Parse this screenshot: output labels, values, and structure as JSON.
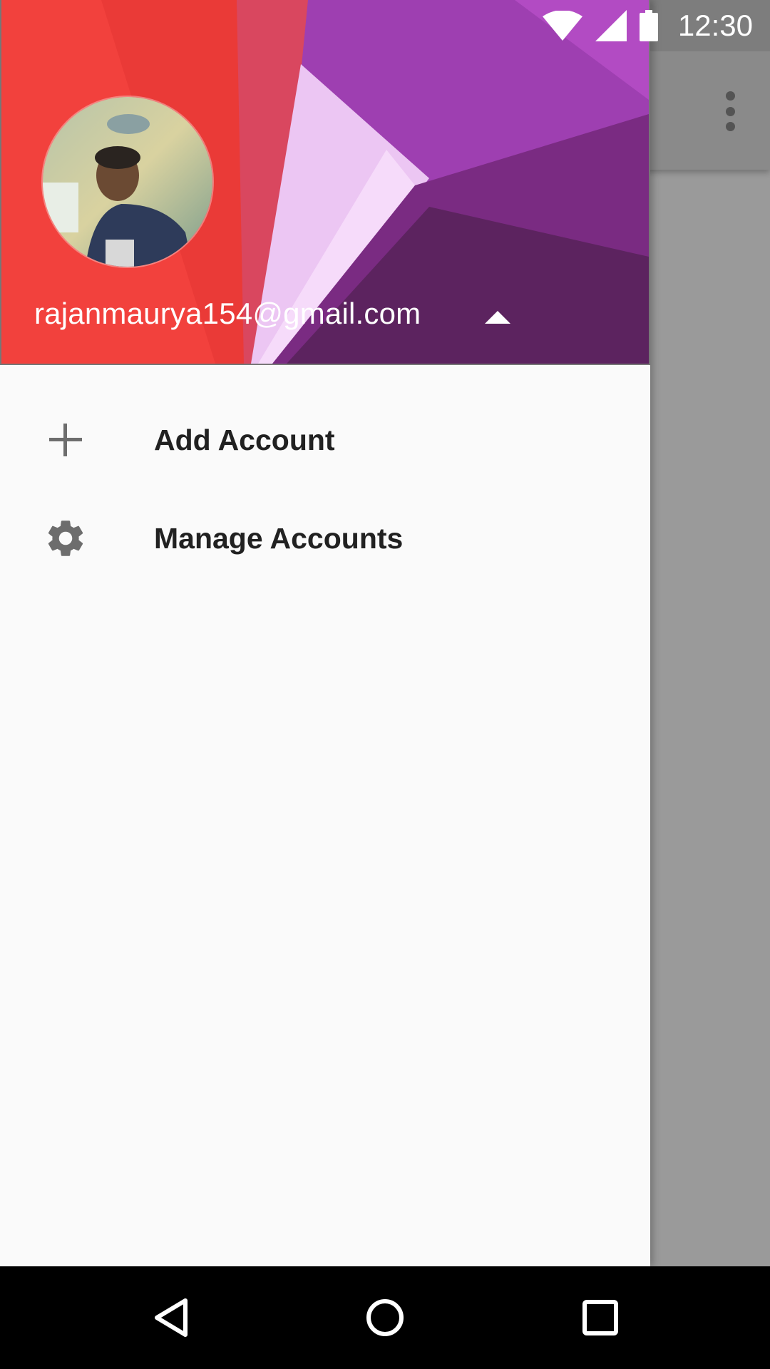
{
  "status_bar": {
    "time": "12:30",
    "icons": [
      "wifi-icon",
      "cellular-signal-icon",
      "battery-icon"
    ]
  },
  "app_bar": {
    "overflow_icon": "more-vert-icon"
  },
  "drawer": {
    "header": {
      "email": "rajanmaurya154@gmail.com",
      "toggle_icon": "arrow-drop-up-icon",
      "avatar": "profile-avatar"
    },
    "items": [
      {
        "label": "Add Account",
        "icon": "add-icon"
      },
      {
        "label": "Manage Accounts",
        "icon": "settings-gear-icon"
      }
    ]
  },
  "nav_bar": {
    "buttons": [
      "back-icon",
      "home-icon",
      "recents-icon"
    ]
  },
  "colors": {
    "header_red": "#f2413d",
    "header_purple": "#a23fb3",
    "drawer_bg": "#fafafa",
    "text_primary": "#212121",
    "icon_gray": "#6d6d6d"
  }
}
